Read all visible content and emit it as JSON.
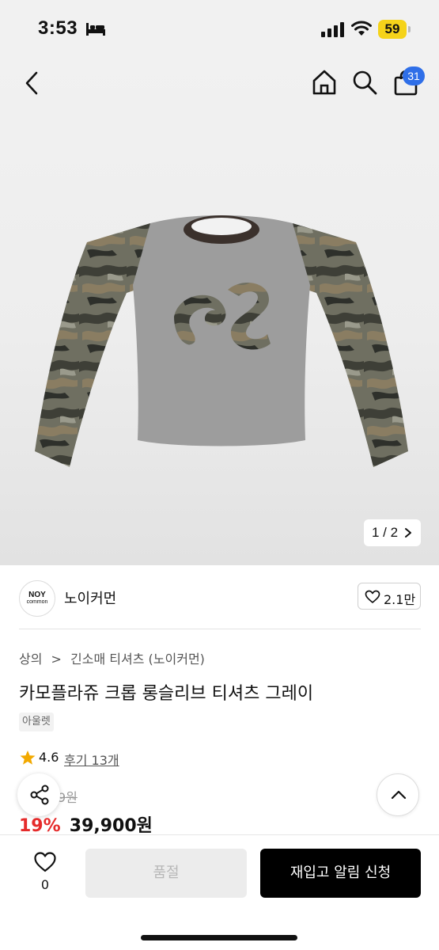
{
  "status": {
    "time": "3:53",
    "battery": "59"
  },
  "header": {
    "cart_count": "31"
  },
  "gallery": {
    "pager": "1 / 2"
  },
  "brand": {
    "logo_line1": "NOY",
    "logo_line2": "common",
    "name": "노이커먼",
    "likes": "2.1만"
  },
  "breadcrumb": {
    "items": [
      "상의",
      ">",
      "긴소매 티셔츠 (노이커먼)"
    ]
  },
  "product": {
    "title": "카모플라쥬 크롭 롱슬리브 티셔츠 그레이",
    "tag": "아울렛",
    "rating": "4.6",
    "reviews": "후기 13개",
    "original_price": "9원",
    "discount": "19%",
    "price": "39,900원"
  },
  "actions": {
    "wish_count": "0",
    "soldout_label": "품절",
    "restock_label": "재입고 알림 신청"
  },
  "colors": {
    "accent_blue": "#2f6fe8",
    "discount_red": "#e52b2b",
    "star": "#f2a900"
  }
}
